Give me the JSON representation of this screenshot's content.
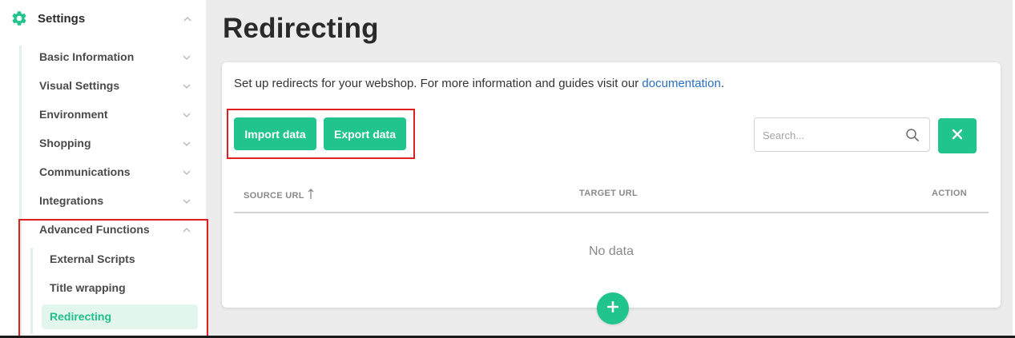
{
  "sidebar": {
    "header": {
      "label": "Settings",
      "icon": "gear-icon"
    },
    "items": [
      {
        "label": "Basic Information"
      },
      {
        "label": "Visual Settings"
      },
      {
        "label": "Environment"
      },
      {
        "label": "Shopping"
      },
      {
        "label": "Communications"
      },
      {
        "label": "Integrations"
      },
      {
        "label": "Advanced Functions",
        "expanded": true
      }
    ],
    "subitems": [
      {
        "label": "External Scripts"
      },
      {
        "label": "Title wrapping"
      },
      {
        "label": "Redirecting",
        "active": true
      }
    ]
  },
  "main": {
    "title": "Redirecting",
    "intro_text": "Set up redirects for your webshop. For more information and guides visit our ",
    "intro_link": "documentation",
    "intro_end": ".",
    "buttons": {
      "import": "Import data",
      "export": "Export data"
    },
    "search": {
      "placeholder": "Search..."
    },
    "table": {
      "columns": [
        "SOURCE URL",
        "TARGET URL",
        "ACTION"
      ],
      "empty": "No data"
    }
  },
  "colors": {
    "accent": "#22c48d",
    "link": "#2a6fc2",
    "highlight": "#e02020"
  }
}
